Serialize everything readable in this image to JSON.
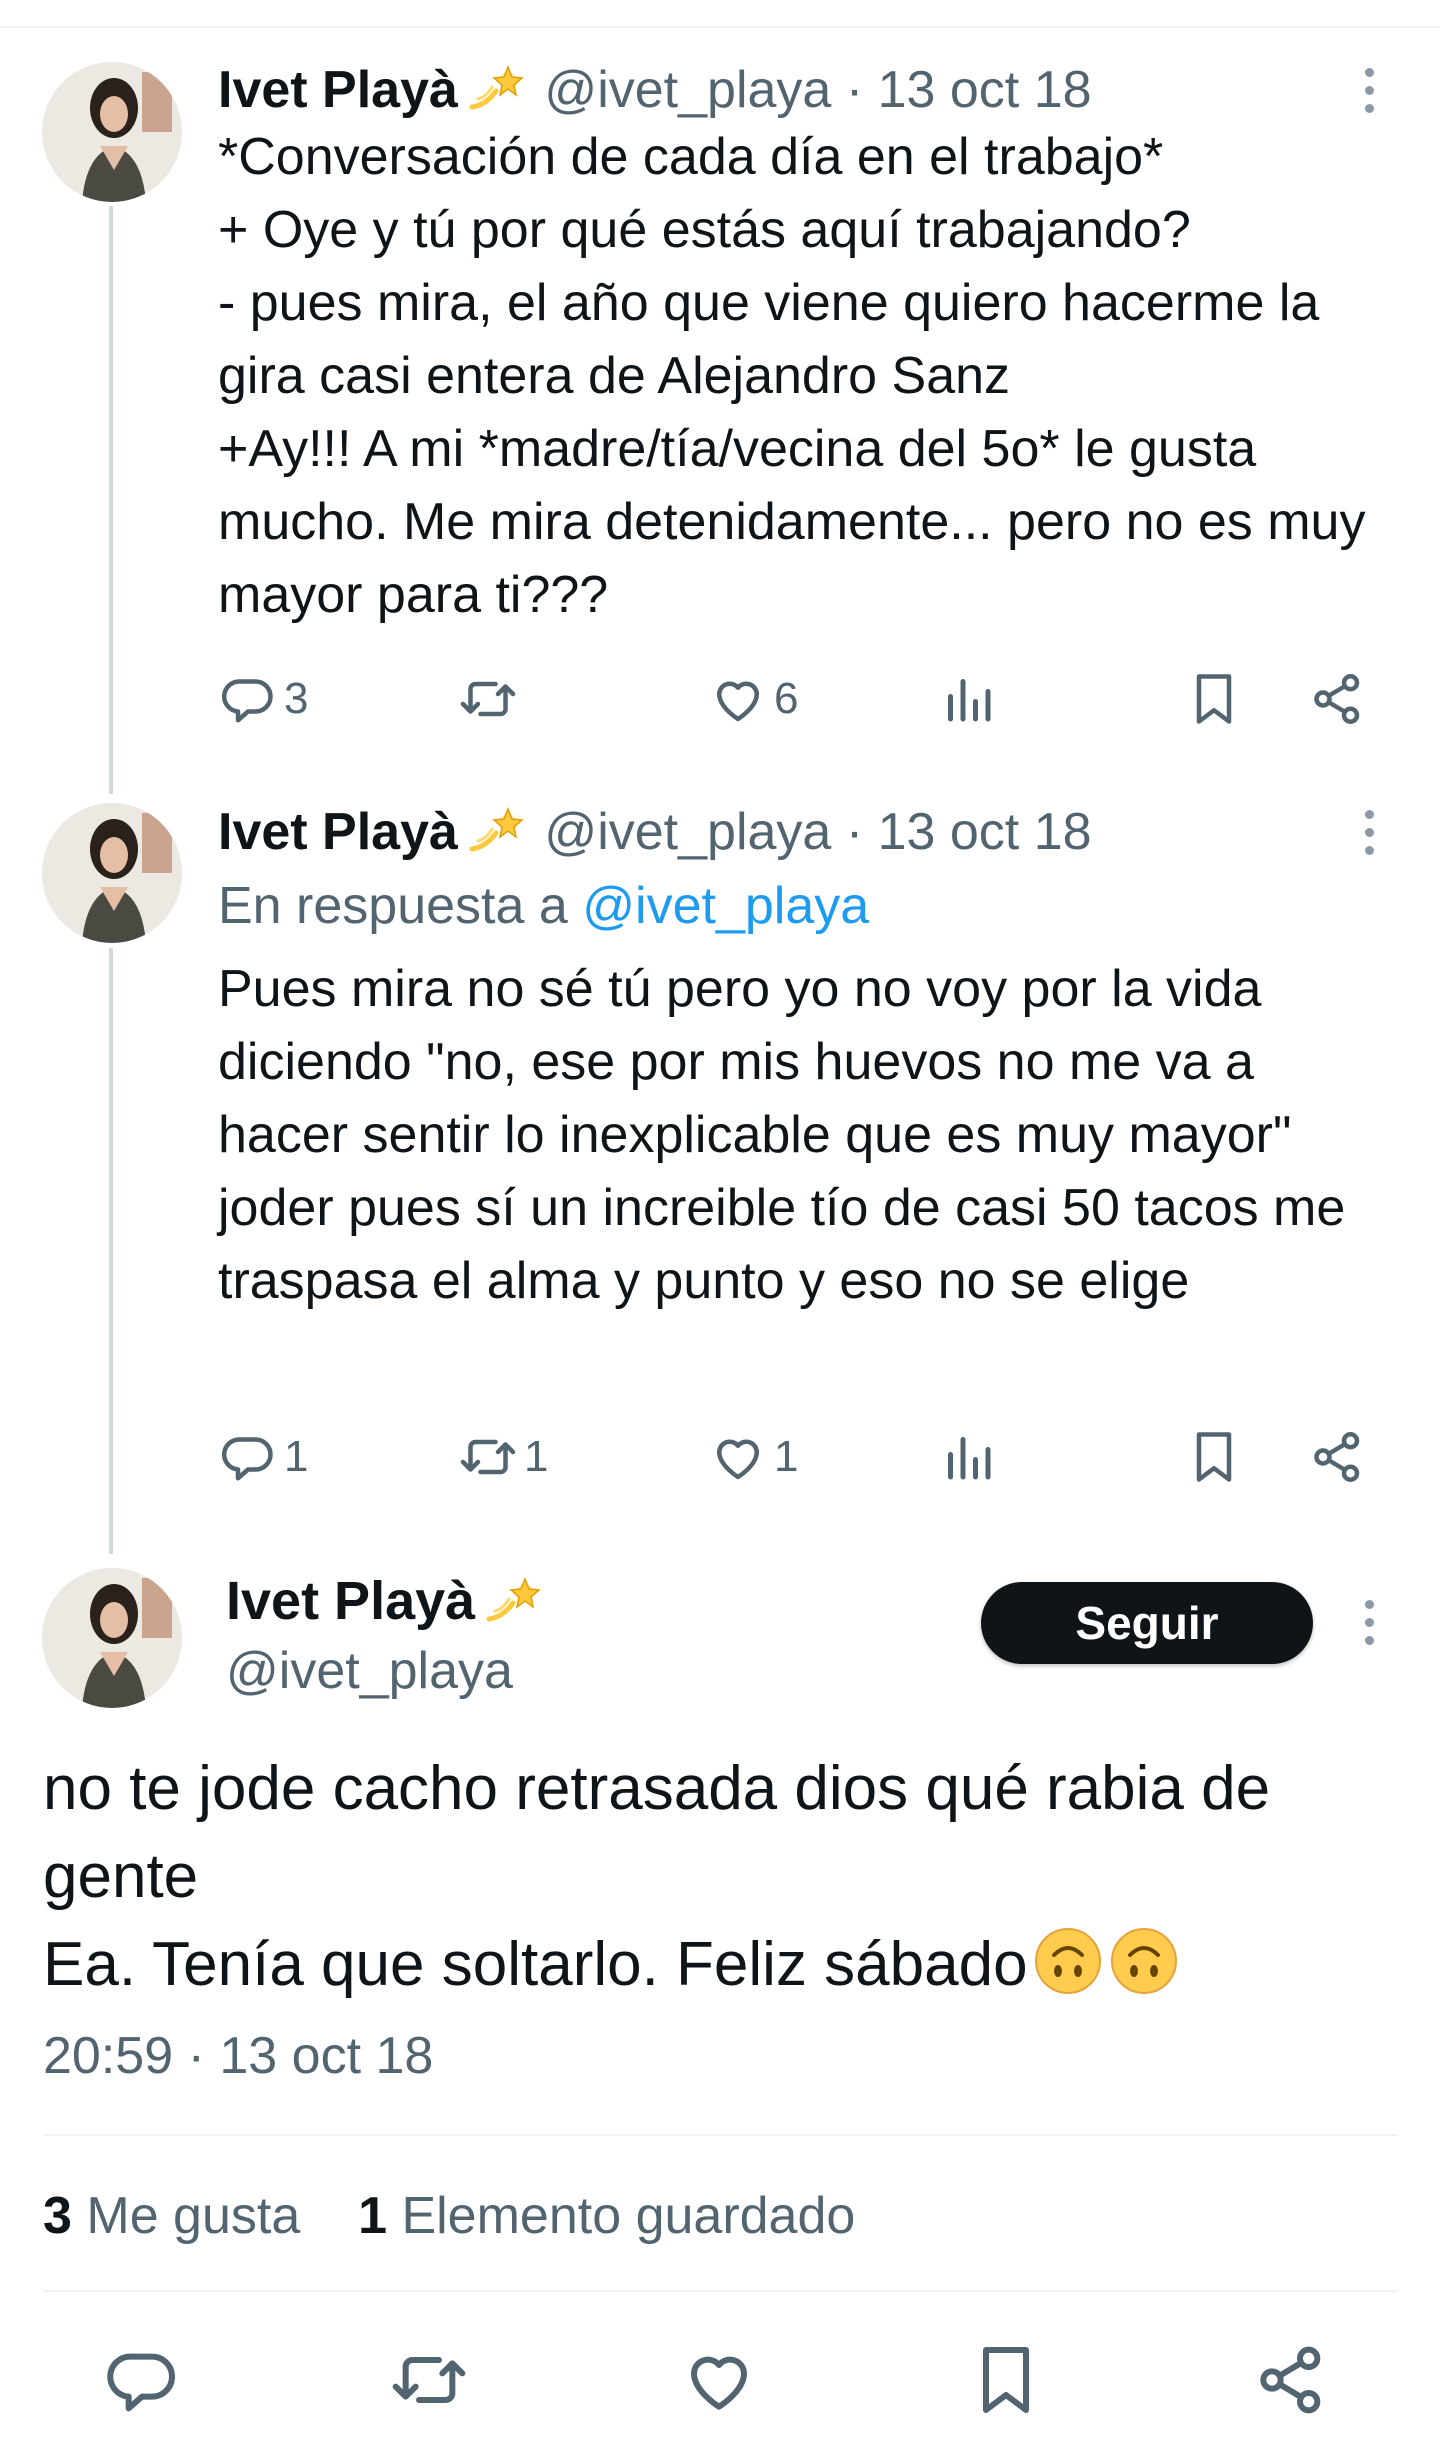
{
  "colors": {
    "text": "#0f1419",
    "secondary": "#536471",
    "link": "#1d9bf0",
    "button_bg": "#0f1419"
  },
  "tweets": [
    {
      "name": "Ivet Playà",
      "badge_icon": "sparkle-star-emoji",
      "handle": "@ivet_playa",
      "separator": "·",
      "date": "13 oct 18",
      "text": "*Conversación de cada día en el trabajo*\n+ Oye y tú por qué estás aquí trabajando?\n- pues mira, el año que viene quiero hacerme la gira casi entera de Alejandro Sanz\n+Ay!!! A mi *madre/tía/vecina del 5o* le gusta mucho. Me mira detenidamente... pero no es muy mayor para ti???",
      "counts": {
        "replies": "3",
        "retweets": "",
        "likes": "6"
      }
    },
    {
      "name": "Ivet Playà",
      "badge_icon": "sparkle-star-emoji",
      "handle": "@ivet_playa",
      "separator": "·",
      "date": "13 oct 18",
      "reply_prefix": "En respuesta a",
      "reply_handle": "@ivet_playa",
      "text": "Pues mira no sé tú pero yo no voy por la vida diciendo \"no, ese por mis huevos no me va a hacer sentir lo inexplicable que es muy mayor\" joder pues sí un increible tío de casi 50 tacos me traspasa el alma y punto y eso no se elige",
      "counts": {
        "replies": "1",
        "retweets": "1",
        "likes": "1"
      }
    }
  ],
  "main_tweet": {
    "name": "Ivet Playà",
    "badge_icon": "sparkle-star-emoji",
    "handle": "@ivet_playa",
    "follow_label": "Seguir",
    "text": "no te jode cacho retrasada dios qué rabia de gente\nEa. Tenía que soltarlo. Feliz sábado",
    "trailing_emoji": "upside-down-face-emoji",
    "time": "20:59",
    "separator": "·",
    "date": "13 oct 18",
    "likes_count": "3",
    "likes_label": "Me gusta",
    "saved_count": "1",
    "saved_label": "Elemento guardado"
  }
}
